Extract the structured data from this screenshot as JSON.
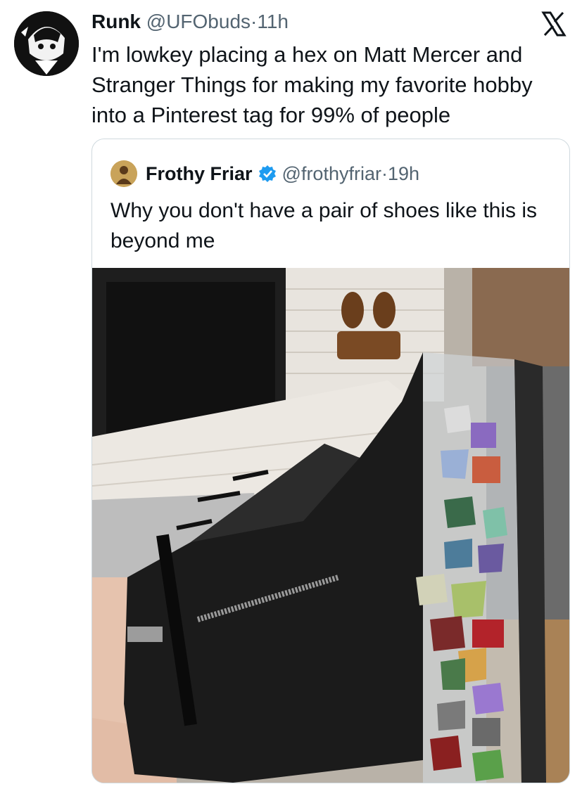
{
  "tweet": {
    "author_name": "Runk",
    "handle": "@UFObuds",
    "separator": "·",
    "time": "11h",
    "text": "I'm lowkey placing a hex on Matt Mercer and Stranger Things for making my favorite hobby into a Pinterest tag for 99% of people"
  },
  "quoted": {
    "author_name": "Frothy Friar",
    "handle": "@frothyfriar",
    "separator": "·",
    "time": "19h",
    "text": "Why you don't have a pair of shoes like this is beyond me"
  },
  "icons": {
    "close": "x-logo-icon",
    "verified": "verified-badge-icon"
  },
  "colors": {
    "text": "#0f1419",
    "muted": "#536471",
    "verified": "#1d9bf0",
    "border": "#cfd9de"
  }
}
